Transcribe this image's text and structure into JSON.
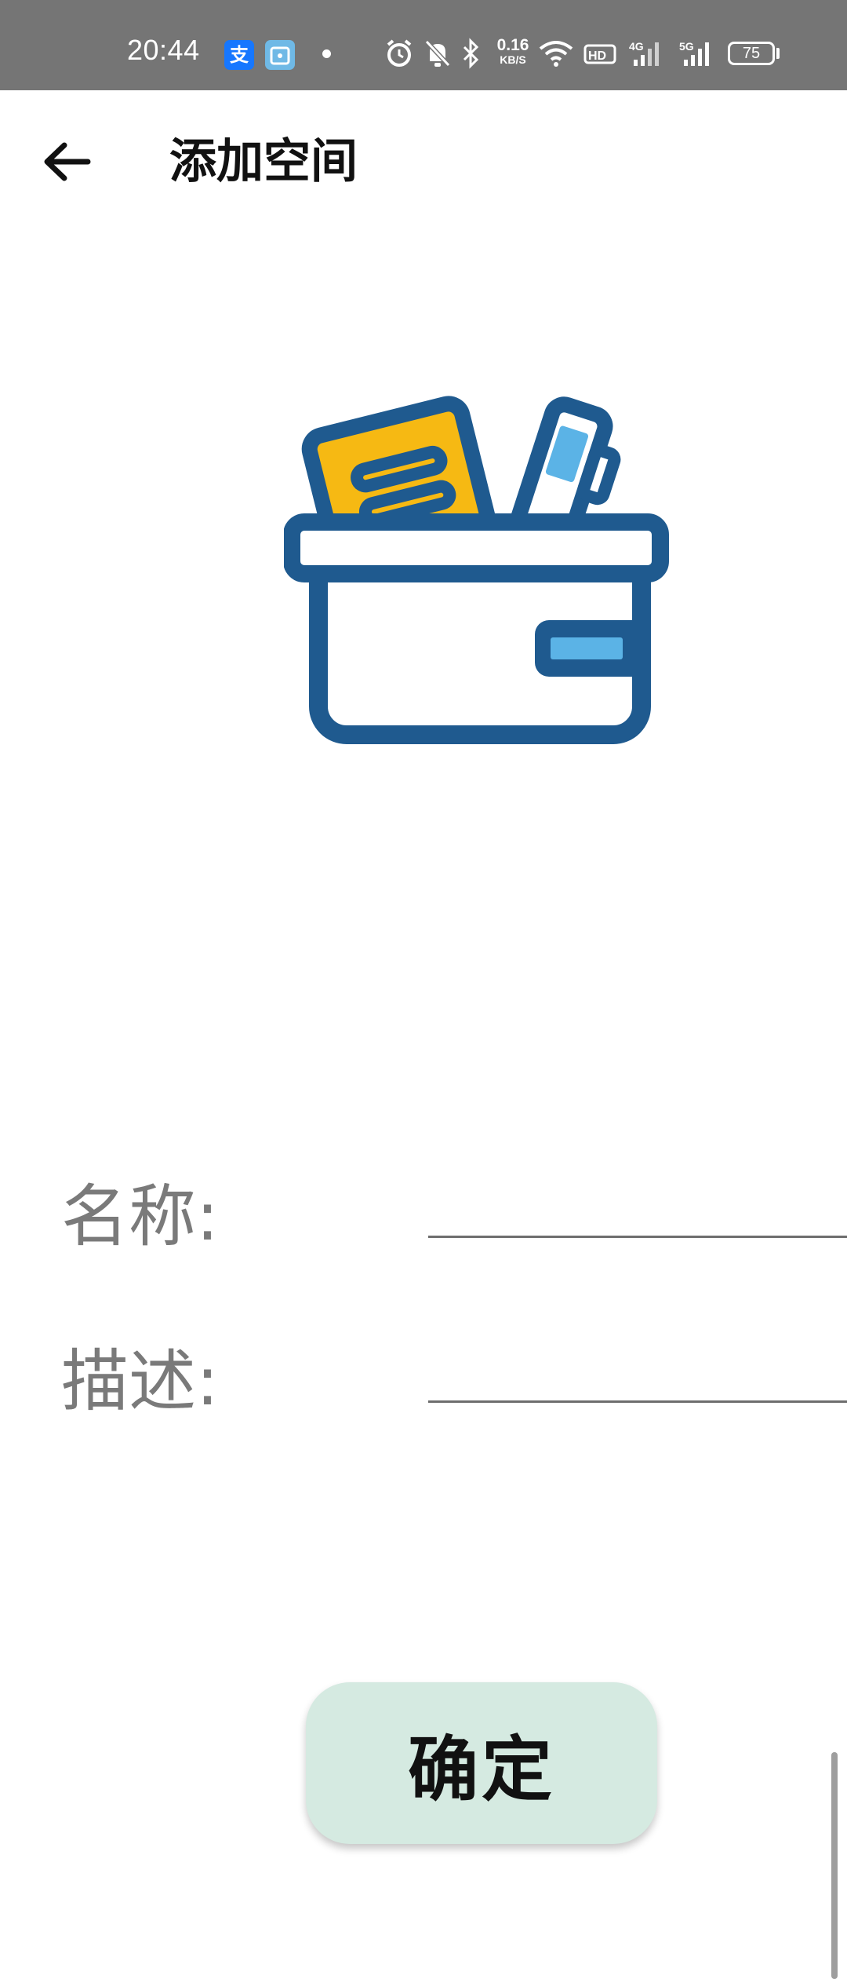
{
  "status_bar": {
    "time": "20:44",
    "app_icons": [
      {
        "name": "alipay-icon",
        "glyph": "支",
        "color": "#1677ff"
      },
      {
        "name": "app-box-icon",
        "glyph": "▣",
        "color": "#6fb9e6"
      }
    ],
    "net_speed_value": "0.16",
    "net_speed_unit": "KB/S",
    "battery_level": "75",
    "icons": [
      "alarm-icon",
      "mute-bell-icon",
      "bluetooth-icon",
      "wifi-icon",
      "hd-icon",
      "signal-4g-icon",
      "signal-5g-icon",
      "battery-icon"
    ]
  },
  "app_bar": {
    "title": "添加空间",
    "back_icon": "arrow-left-icon"
  },
  "illustration": {
    "icon": "storage-box-icon",
    "colors": {
      "outline": "#1f5a8f",
      "card": "#f6b913",
      "accent": "#5bb3e6"
    }
  },
  "form": {
    "name_label": "名称:",
    "name_value": "",
    "description_label": "描述:",
    "description_value": ""
  },
  "confirm_label": "确定",
  "colors": {
    "status_bar_bg": "#757575",
    "button_bg": "#d5eae1",
    "label_text": "#7a7a7a"
  }
}
